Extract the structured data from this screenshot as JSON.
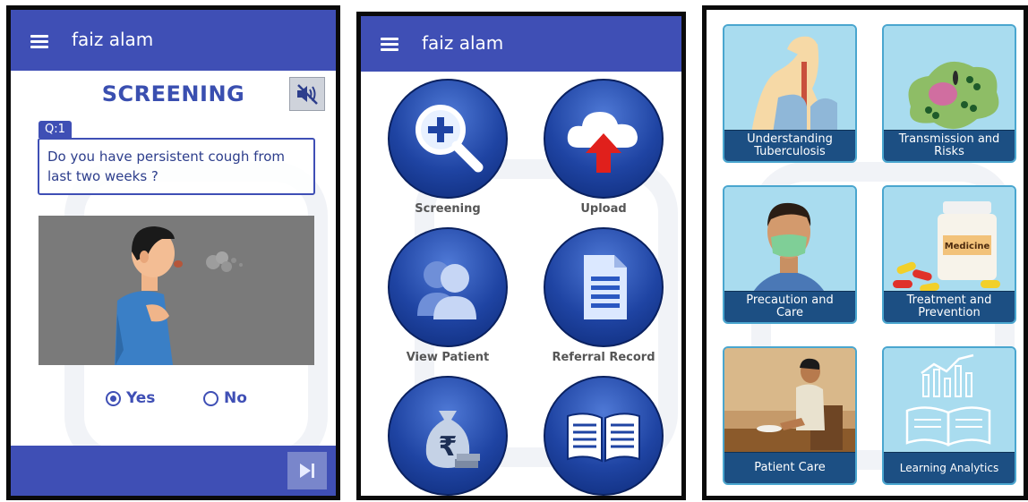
{
  "screening_screen": {
    "app_bar": {
      "menu_icon": "hamburger-menu-icon",
      "user_name": "faiz alam"
    },
    "title": "SCREENING",
    "mute_icon": "speaker-muted-icon",
    "question": {
      "number_label": "Q:1",
      "text": "Do you have persistent cough from last two weeks ?"
    },
    "illustration": "man-coughing-illustration",
    "options": [
      {
        "label": "Yes",
        "selected": true
      },
      {
        "label": "No",
        "selected": false
      }
    ],
    "next_icon": "skip-next-icon"
  },
  "menu_screen": {
    "app_bar": {
      "menu_icon": "hamburger-menu-icon",
      "user_name": "faiz alam"
    },
    "tiles": [
      {
        "label": "Screening",
        "icon": "magnifier-plus-icon"
      },
      {
        "label": "Upload",
        "icon": "cloud-upload-icon"
      },
      {
        "label": "View Patient",
        "icon": "patient-icon"
      },
      {
        "label": "Referral Record",
        "icon": "document-icon"
      },
      {
        "label": "",
        "icon": "rupee-money-bag-icon"
      },
      {
        "label": "",
        "icon": "open-book-icon"
      }
    ]
  },
  "learning_screen": {
    "cards": [
      {
        "label_line1": "Understanding",
        "label_line2": "Tuberculosis",
        "art": "respiratory-system-illustration"
      },
      {
        "label_line1": "Transmission and",
        "label_line2": "Risks",
        "art": "bacteria-illustration"
      },
      {
        "label_line1": "Precaution and",
        "label_line2": "Care",
        "art": "man-with-mask-illustration"
      },
      {
        "label_line1": "Treatment and",
        "label_line2": "Prevention",
        "art": "medicine-bottle-pills-illustration",
        "bottle_label": "Medicine"
      },
      {
        "label_line1": "Patient Care",
        "label_line2": "",
        "art": "patient-eating-illustration"
      },
      {
        "label_line1": "Learning Analytics",
        "label_line2": "",
        "art": "analytics-book-illustration"
      }
    ]
  },
  "colors": {
    "app_bar": "#3f4fb5",
    "tile_blue": "#1f44a3",
    "card_caption": "#1c4f83",
    "card_bg": "#a9dcef"
  }
}
